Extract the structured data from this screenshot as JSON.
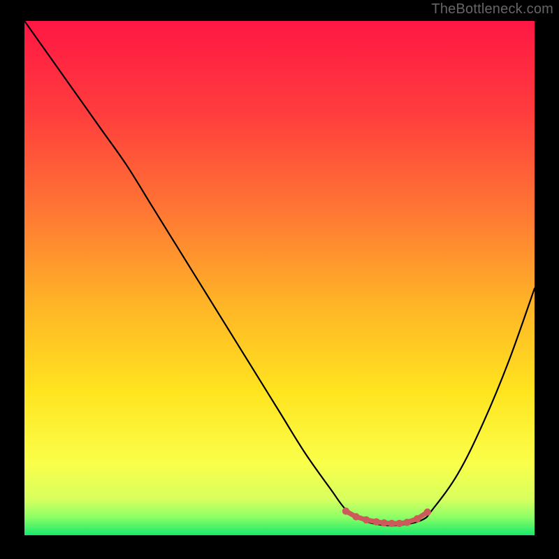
{
  "watermark": "TheBottleneck.com",
  "chart_data": {
    "type": "line",
    "title": "",
    "xlabel": "",
    "ylabel": "",
    "xlim": [
      0,
      100
    ],
    "ylim": [
      0,
      100
    ],
    "series": [
      {
        "name": "curve",
        "x": [
          0,
          5,
          10,
          15,
          20,
          25,
          30,
          35,
          40,
          45,
          50,
          55,
          60,
          63,
          66,
          70,
          74,
          78,
          80,
          85,
          90,
          95,
          100
        ],
        "y": [
          100,
          93,
          86,
          79,
          72,
          64,
          56,
          48,
          40,
          32,
          24,
          16,
          9,
          5,
          3,
          2,
          2,
          3,
          5,
          12,
          22,
          34,
          48
        ]
      }
    ],
    "markers": {
      "name": "bottom-markers",
      "color": "#cc5a5a",
      "x": [
        63,
        65,
        67,
        69,
        70.5,
        72,
        73.5,
        75,
        77,
        79
      ],
      "y": [
        4.7,
        3.6,
        3.0,
        2.6,
        2.4,
        2.3,
        2.3,
        2.5,
        3.2,
        4.5
      ]
    },
    "gradient_stops": [
      {
        "offset": 0.0,
        "color": "#ff1744"
      },
      {
        "offset": 0.18,
        "color": "#ff3d3d"
      },
      {
        "offset": 0.38,
        "color": "#ff7a33"
      },
      {
        "offset": 0.55,
        "color": "#ffb427"
      },
      {
        "offset": 0.72,
        "color": "#ffe41f"
      },
      {
        "offset": 0.86,
        "color": "#faff4a"
      },
      {
        "offset": 0.93,
        "color": "#d7ff5e"
      },
      {
        "offset": 0.965,
        "color": "#8dff66"
      },
      {
        "offset": 1.0,
        "color": "#17e86b"
      }
    ]
  }
}
